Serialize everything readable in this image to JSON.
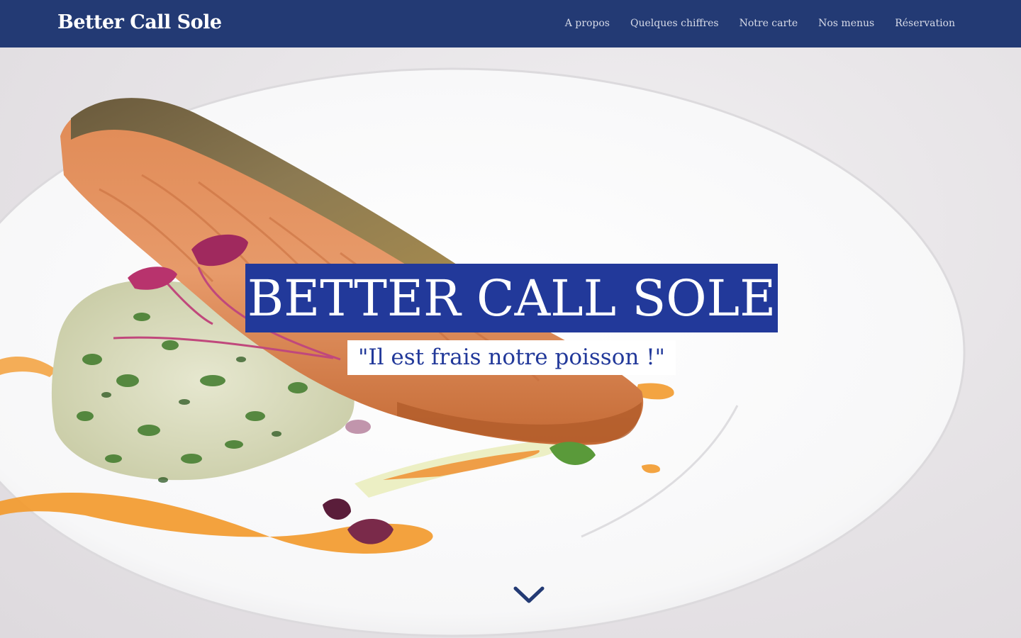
{
  "header": {
    "logo": "Better Call Sole",
    "nav": [
      {
        "label": "A propos"
      },
      {
        "label": "Quelques chiffres"
      },
      {
        "label": "Notre carte"
      },
      {
        "label": "Nos menus"
      },
      {
        "label": "Réservation"
      }
    ]
  },
  "hero": {
    "title": "BETTER CALL SOLE",
    "subtitle": "\"Il est frais notre poisson !\"",
    "scroll_icon": "chevron-down-icon"
  },
  "colors": {
    "header_bg": "#233a74",
    "accent_blue": "#22399a",
    "white": "#ffffff"
  }
}
